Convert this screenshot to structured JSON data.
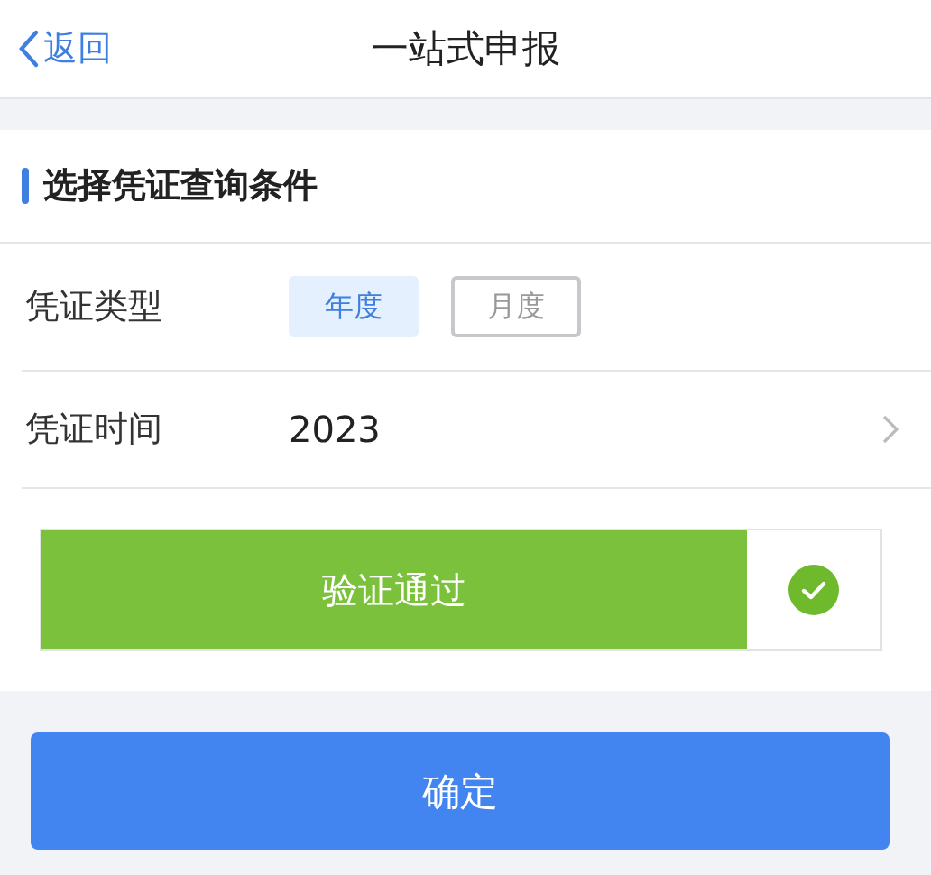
{
  "header": {
    "back": "返回",
    "title": "一站式申报"
  },
  "section": {
    "title": "选择凭证查询条件",
    "rows": [
      {
        "kind": "options",
        "label": "凭证类型",
        "options": [
          {
            "label": "年度",
            "selected": true
          },
          {
            "label": "月度",
            "selected": false
          }
        ]
      },
      {
        "kind": "picker",
        "label": "凭证时间",
        "value": "2023"
      }
    ]
  },
  "verify": {
    "text": "验证通过",
    "verified": true
  },
  "confirm": "确定"
}
